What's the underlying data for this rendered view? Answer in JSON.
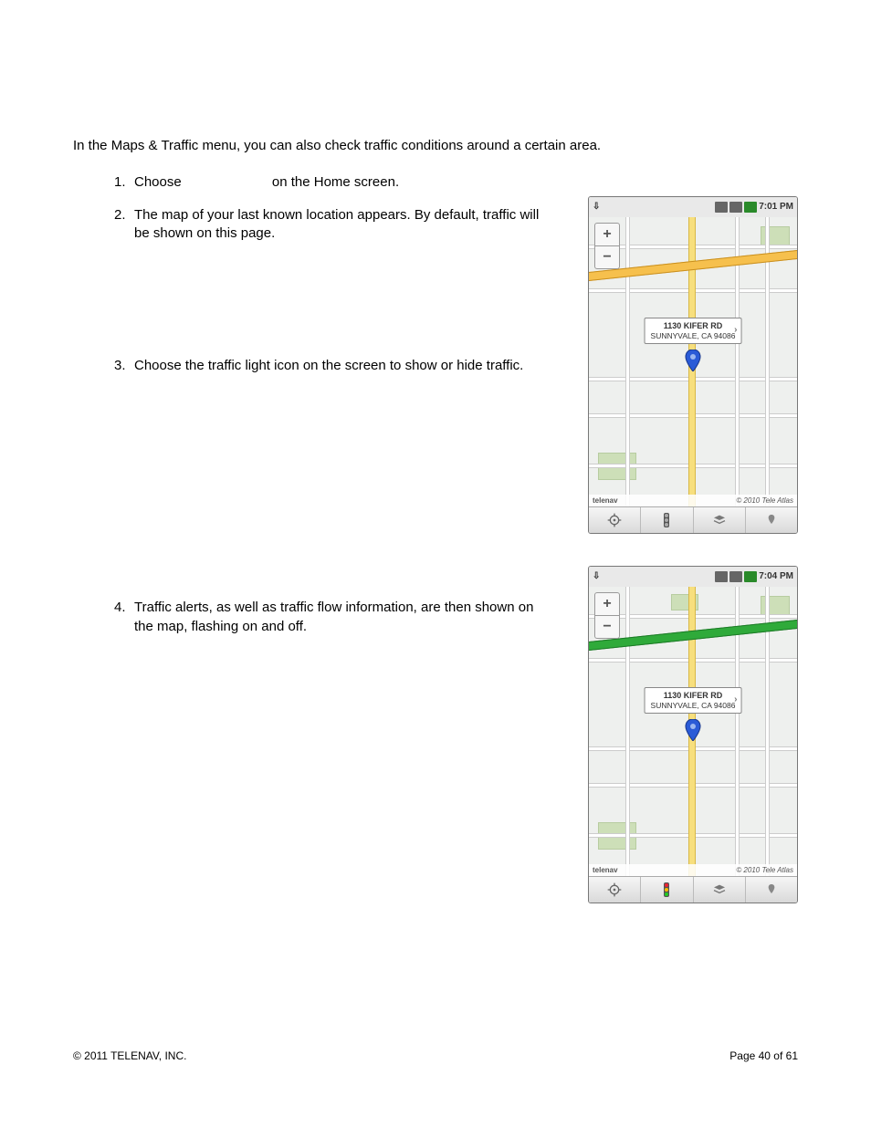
{
  "intro": "In the Maps & Traffic menu, you can also check traffic conditions around a certain area.",
  "steps": {
    "s1": {
      "num": "1.",
      "pre": "Choose",
      "post": "on the Home screen."
    },
    "s2": {
      "num": "2.",
      "text": "The map of your last known location appears. By default, traffic will be shown on this page."
    },
    "s3": {
      "num": "3.",
      "text": "Choose the traffic light icon on the screen to show or hide traffic."
    },
    "s4": {
      "num": "4.",
      "text": "Traffic alerts, as well as traffic flow information, are then shown on the map, flashing on and off."
    }
  },
  "shot1": {
    "time": "7:01 PM",
    "addr1": "1130 KIFER RD",
    "addr2": "SUNNYVALE, CA 94086",
    "brand": "telenav",
    "copy": "© 2010 Tele Atlas"
  },
  "shot2": {
    "time": "7:04 PM",
    "addr1": "1130 KIFER RD",
    "addr2": "SUNNYVALE, CA 94086",
    "brand": "telenav",
    "copy": "© 2010 Tele Atlas"
  },
  "footer": {
    "left": "© 2011 TELENAV, INC.",
    "right": "Page 40 of 61"
  }
}
